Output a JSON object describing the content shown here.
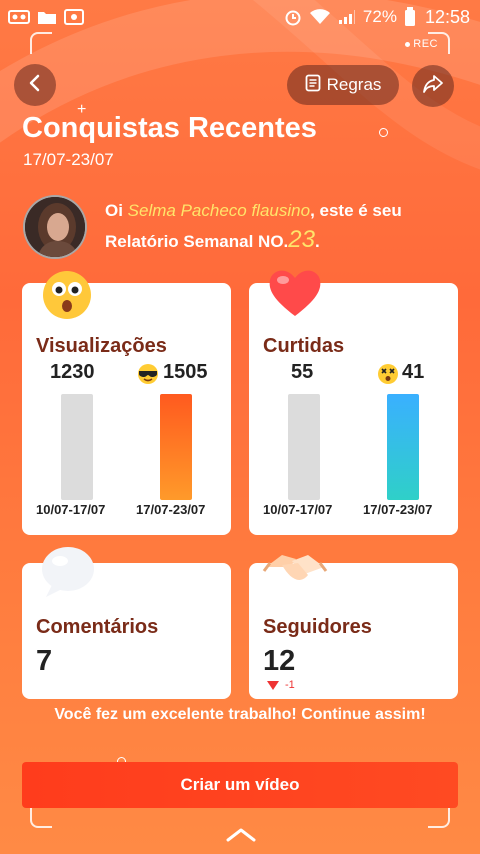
{
  "status_bar": {
    "battery_pct": "72%",
    "time": "12:58",
    "rec_label": "REC"
  },
  "header": {
    "rules_label": "Regras",
    "title": "Conquistas Recentes",
    "date_range": "17/07-23/07"
  },
  "greeting": {
    "prefix": "Oi ",
    "name": "Selma Pacheco flausino",
    "middle": ", este é seu Relatório Semanal NO.",
    "number": "23",
    "suffix": "."
  },
  "cards": {
    "views": {
      "label": "Visualizações",
      "prev_value": "1230",
      "cur_value": "1505",
      "prev_date": "10/07-17/07",
      "cur_date": "17/07-23/07"
    },
    "likes": {
      "label": "Curtidas",
      "prev_value": "55",
      "cur_value": "41",
      "prev_date": "10/07-17/07",
      "cur_date": "17/07-23/07"
    },
    "comments": {
      "label": "Comentários",
      "value": "7"
    },
    "followers": {
      "label": "Seguidores",
      "value": "12",
      "delta": "-1"
    }
  },
  "encouragement": "Você fez um excelente trabalho! Continue assim!",
  "cta_label": "Criar um vídeo",
  "colors": {
    "accent": "#ff4a22",
    "card_label": "#7a2b18",
    "highlight": "#ffe46a",
    "delta_down": "#ee3333"
  }
}
